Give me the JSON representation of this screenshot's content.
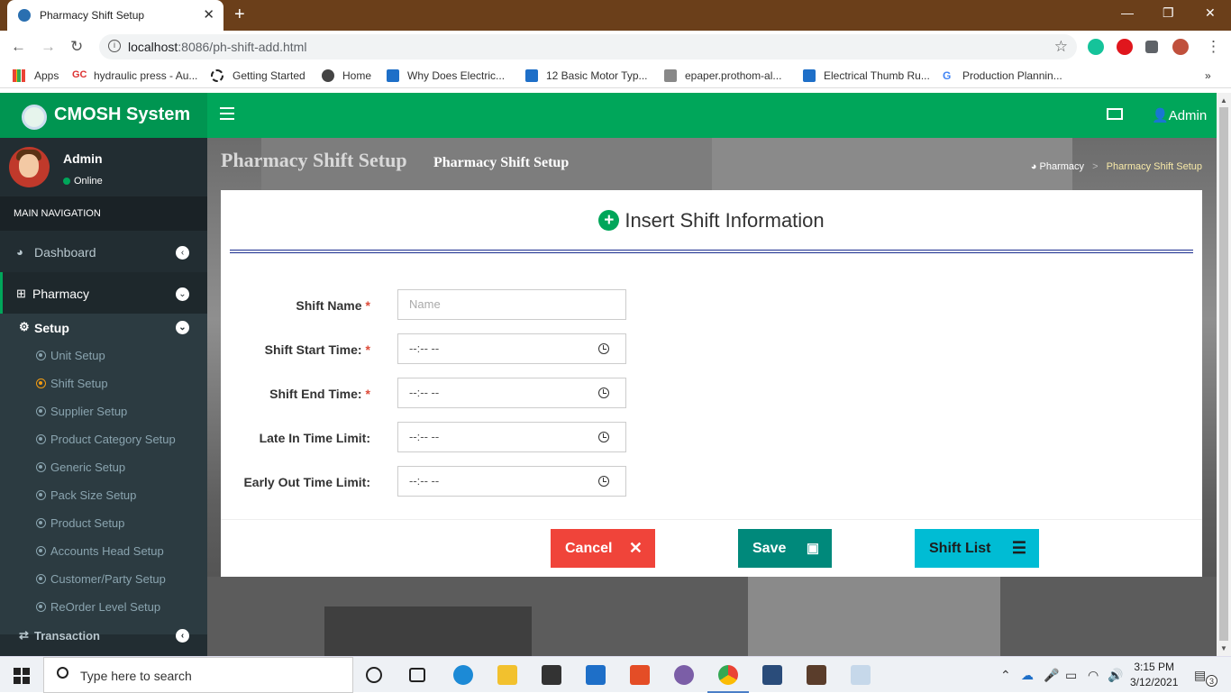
{
  "browser": {
    "tab_title": "Pharmacy Shift Setup",
    "url_host": "localhost",
    "url_rest": ":8086/ph-shift-add.html",
    "bookmarks": [
      {
        "label": "Apps"
      },
      {
        "label": "hydraulic press - Au..."
      },
      {
        "label": "Getting Started"
      },
      {
        "label": "Home"
      },
      {
        "label": "Why Does Electric..."
      },
      {
        "label": "12 Basic Motor Typ..."
      },
      {
        "label": "epaper.prothom-al..."
      },
      {
        "label": "Electrical Thumb Ru..."
      },
      {
        "label": "Production Plannin..."
      }
    ],
    "bookmark_gc": "GC"
  },
  "app": {
    "brand": "CMOSH System",
    "header_user": "Admin",
    "colors": {
      "green": "#00a65a",
      "sidebar": "#222d32",
      "cancel": "#f0443a",
      "save": "#00897b",
      "list": "#00bcd4"
    }
  },
  "sidebar": {
    "user_name": "Admin",
    "user_status": "Online",
    "nav_header": "MAIN NAVIGATION",
    "dashboard": "Dashboard",
    "pharmacy": "Pharmacy",
    "setup": "Setup",
    "transaction": "Transaction",
    "subitems": [
      {
        "label": "Unit Setup"
      },
      {
        "label": "Shift Setup"
      },
      {
        "label": "Supplier Setup"
      },
      {
        "label": "Product Category Setup"
      },
      {
        "label": "Generic Setup"
      },
      {
        "label": "Pack Size Setup"
      },
      {
        "label": "Product Setup"
      },
      {
        "label": "Accounts Head Setup"
      },
      {
        "label": "Customer/Party Setup"
      },
      {
        "label": "ReOrder Level Setup"
      }
    ]
  },
  "page": {
    "title": "Pharmacy Shift Setup",
    "subtitle": "Pharmacy Shift Setup",
    "breadcrumb": [
      "Pharmacy",
      "Pharmacy Shift Setup"
    ],
    "breadcrumb_sep": ">"
  },
  "form": {
    "heading": "Insert Shift Information",
    "required_mark": "*",
    "fields": [
      {
        "label": "Shift Name",
        "placeholder": "Name",
        "required": true
      },
      {
        "label": "Shift Start Time:",
        "value": "--:-- --",
        "required": true
      },
      {
        "label": "Shift End Time:",
        "value": "--:-- --",
        "required": true
      },
      {
        "label": "Late In Time Limit:",
        "value": "--:-- --",
        "required": false
      },
      {
        "label": "Early Out Time Limit:",
        "value": "--:-- --",
        "required": false
      }
    ],
    "buttons": {
      "cancel": "Cancel",
      "save": "Save",
      "list": "Shift List"
    }
  },
  "taskbar": {
    "search_placeholder": "Type here to search",
    "time": "3:15 PM",
    "date": "3/12/2021",
    "notif_count": "3"
  }
}
